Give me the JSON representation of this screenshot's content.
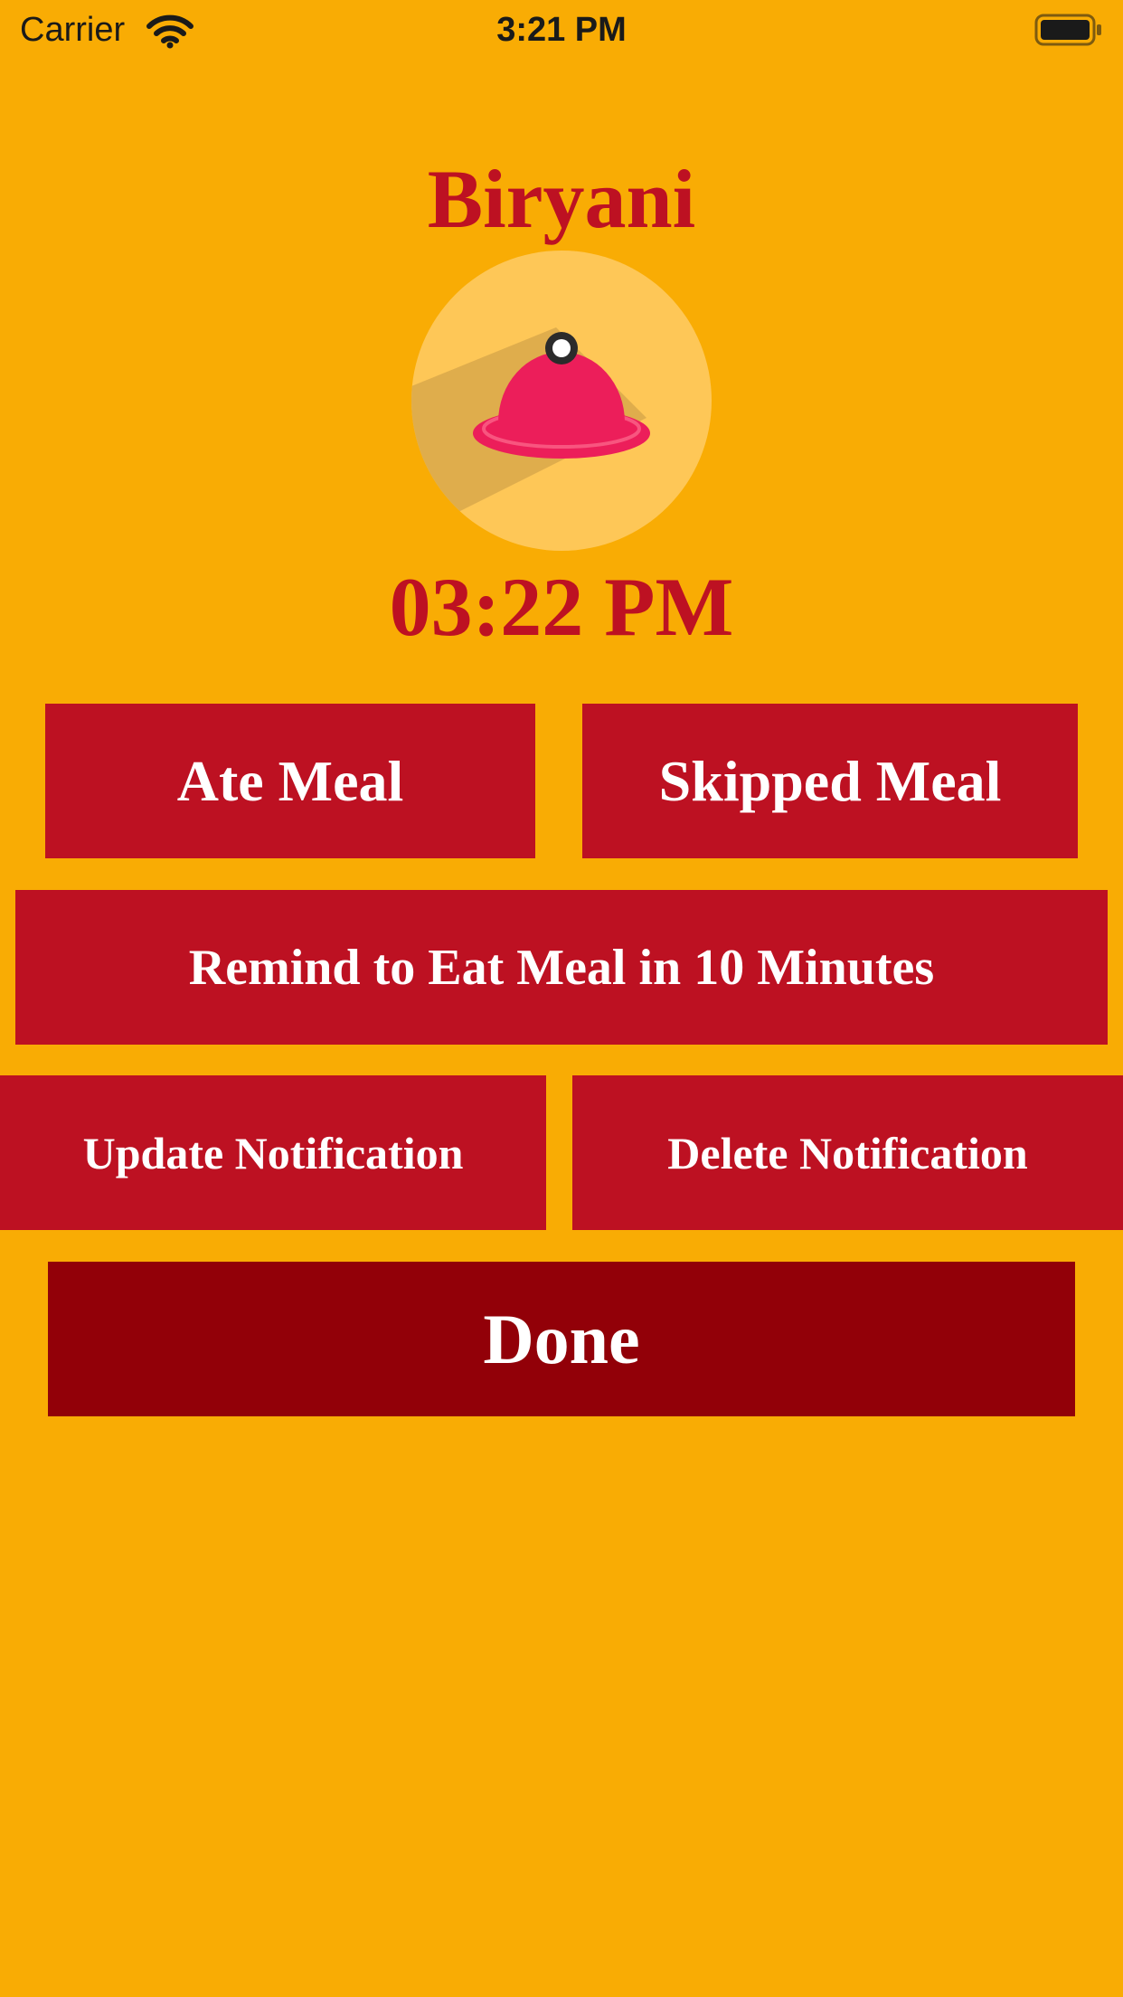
{
  "status_bar": {
    "carrier": "Carrier",
    "time": "3:21 PM",
    "wifi_icon": "wifi-icon",
    "battery_icon": "battery-icon"
  },
  "meal": {
    "name": "Biryani",
    "icon": "cloche-icon",
    "time": "03:22 PM"
  },
  "actions": {
    "ate_label": "Ate Meal",
    "skipped_label": "Skipped Meal",
    "remind_label": "Remind to Eat Meal in 10 Minutes",
    "update_label": "Update Notification",
    "delete_label": "Delete Notification",
    "done_label": "Done"
  },
  "colors": {
    "background": "#F9AC04",
    "accent_text": "#BD1122",
    "button": "#BD1122",
    "done_button": "#920008",
    "button_text": "#FFFFFF",
    "icon_circle": "#FEC757",
    "cloche": "#EC1E5A"
  }
}
